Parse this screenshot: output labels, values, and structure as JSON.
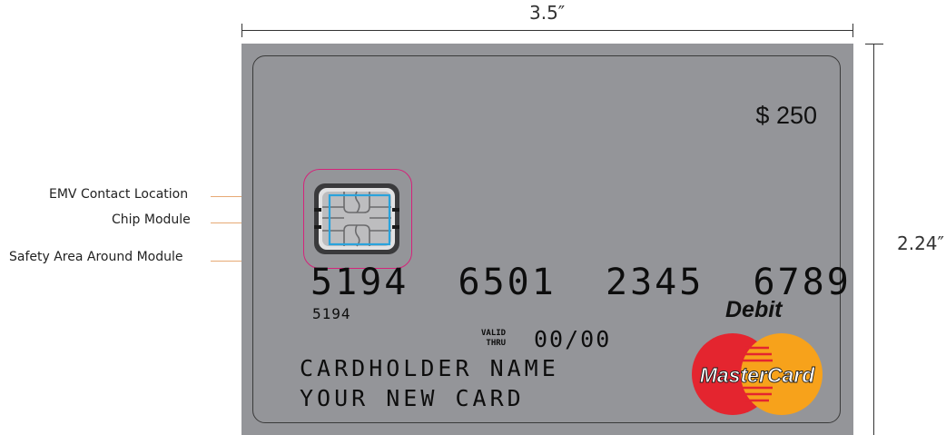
{
  "dimensions": {
    "width_label": "3.5″",
    "height_label": "2.24″"
  },
  "callouts": {
    "emv": "EMV Contact Location",
    "chip": "Chip Module",
    "safety": "Safety Area Around Module"
  },
  "card": {
    "amount": "$ 250",
    "card_number": "5194  6501  2345  6789",
    "card_number_short": "5194",
    "valid_line1": "VALID",
    "valid_line2": "THRU",
    "expiry": "00/00",
    "cardholder_line1": "CARDHOLDER NAME",
    "cardholder_line2": "YOUR NEW CARD",
    "card_type": "Debit",
    "brand": "MasterCard"
  },
  "colors": {
    "card_background": "#949599",
    "safety_area": "#d4237a",
    "emv_contact": "#2aa3dc",
    "leader_lines": "#e7a975",
    "mc_red": "#e4252f",
    "mc_orange": "#f7a21b"
  }
}
